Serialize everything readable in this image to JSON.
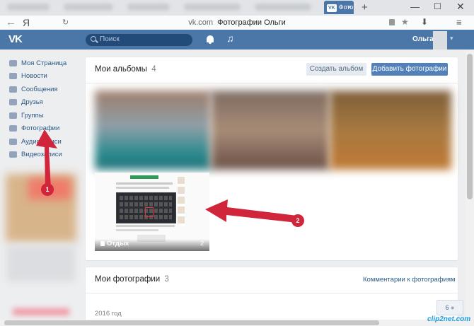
{
  "browser": {
    "yandex_glyph": "Я",
    "tab_badge": "VK",
    "tab_label": "Фото",
    "tab_close": "×",
    "new_tab": "+",
    "url_domain": "vk.com",
    "url_title": "Фотографии Ольги",
    "win_min": "—",
    "win_max": "☐",
    "win_close": "✕",
    "back": "←",
    "refresh": "↻",
    "star": "★",
    "download": "⬇",
    "menu": "≡"
  },
  "header": {
    "logo": "VK",
    "search_placeholder": "Поиск",
    "music_icon": "♫",
    "user_name": "Ольга",
    "user_chevron": "▾"
  },
  "sidebar": {
    "items": [
      {
        "label": "Моя Страница"
      },
      {
        "label": "Новости"
      },
      {
        "label": "Сообщения"
      },
      {
        "label": "Друзья"
      },
      {
        "label": "Группы"
      },
      {
        "label": "Фотографии"
      },
      {
        "label": "Аудиозаписи"
      },
      {
        "label": "Видеозаписи"
      }
    ]
  },
  "albums": {
    "title": "Мои альбомы",
    "count": "4",
    "create_label": "Создать альбом",
    "add_label": "Добавить фотографии",
    "featured": {
      "name": "Отдых",
      "count": "2"
    }
  },
  "photos": {
    "title": "Мои фотографии",
    "count": "3",
    "comments_link": "Комментарии к фотографиям",
    "year": "2016 год"
  },
  "annotations": [
    {
      "number": "1"
    },
    {
      "number": "2"
    }
  ],
  "floating_badge": "6",
  "watermark": "clip2net.com",
  "colors": {
    "vk_blue": "#4a76a8",
    "link": "#2a5885",
    "arrow_red": "#d0253a"
  }
}
